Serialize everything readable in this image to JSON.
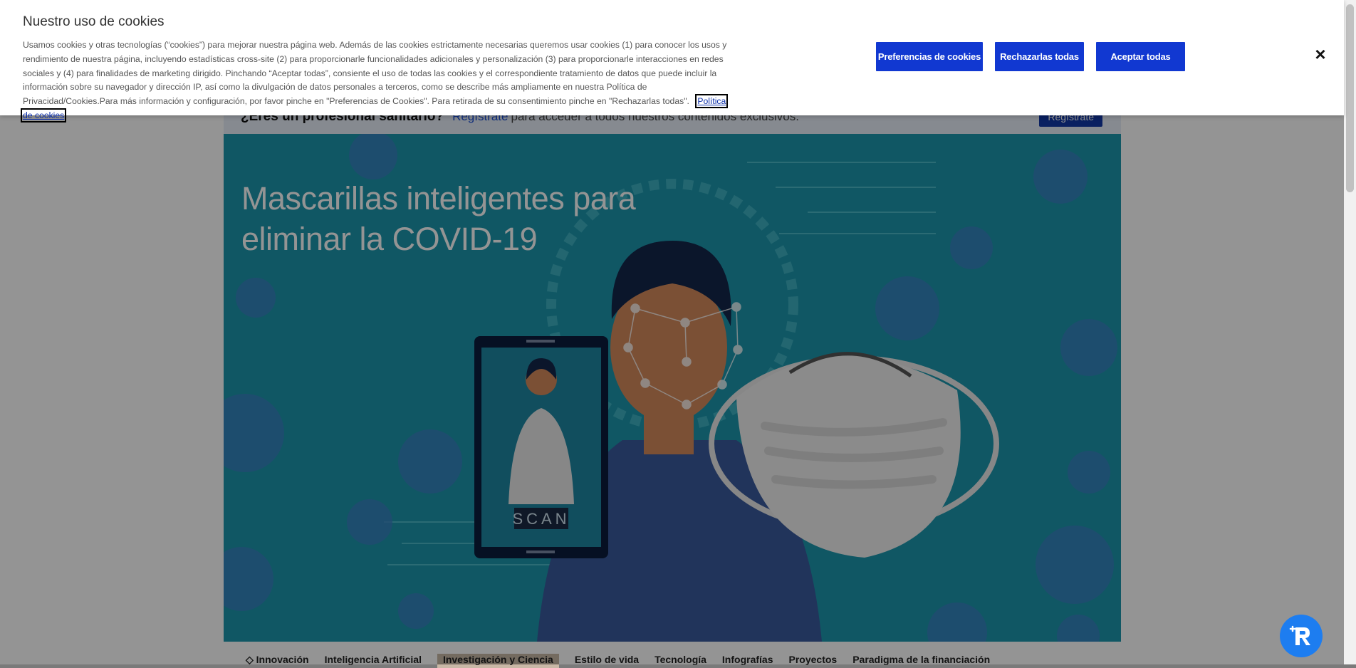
{
  "cookie_banner": {
    "title": "Nuestro uso de cookies",
    "text": "Usamos cookies y otras tecnologías (“cookies”) para mejorar nuestra página web. Además de las cookies estrictamente necesarias queremos usar cookies (1) para conocer los usos y rendimiento de nuestra página, incluyendo estadísticas cross-site (2) para proporcionarle funcionalidades adicionales y personalización (3) para proporcionarle interacciones en redes sociales y (4) para finalidades de marketing dirigido. Pinchando “Aceptar todas”, consiente el uso de todas las cookies y el correspondiente tratamiento de datos que puede incluir la información sobre su navegador y dirección IP, así como la divulgación de datos personales a terceros, como se describe más ampliamente en nuestra Política de Privacidad/Cookies.Para más información y configuración, por favor pinche en \"Preferencias de Cookies\". Para retirada de su consentimiento pinche en \"Rechazarlas todas\".",
    "policy_link": "Política de cookies",
    "buttons": {
      "preferences": "Preferencias de cookies",
      "reject": "Rechazarlas todas",
      "accept": "Aceptar todas"
    },
    "close_icon": "×"
  },
  "pro_banner": {
    "question": "¿Eres un profesional sanitario?",
    "link": "Regístrate",
    "rest": "para acceder a todos nuestros contenidos exclusivos.",
    "button": "Regístrate"
  },
  "hero": {
    "title": "Mascarillas inteligentes para eliminar la COVID-19",
    "scan_label": "SCAN"
  },
  "tabs": [
    {
      "label": "◇ Innovación"
    },
    {
      "label": "Inteligencia Artificial"
    },
    {
      "label": "Investigación y Ciencia"
    },
    {
      "label": "Estilo de vida"
    },
    {
      "label": "Tecnología"
    },
    {
      "label": "Infografías"
    },
    {
      "label": "Proyectos"
    },
    {
      "label": "Paradigma de la financiación"
    }
  ],
  "chat_fab_icon": "robot-chat-icon"
}
